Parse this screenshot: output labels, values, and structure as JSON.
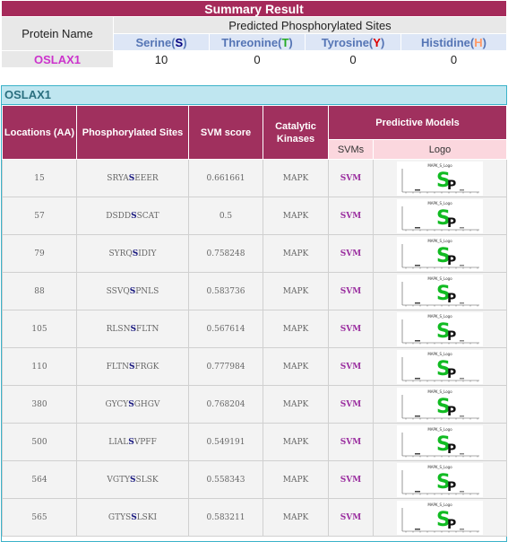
{
  "summary": {
    "title": "Summary Result",
    "protein_name_header": "Protein Name",
    "predicted_header": "Predicted Phosphorylated Sites",
    "residues": [
      {
        "prefix": "Serine(",
        "code": "S",
        "suffix": ")",
        "color": "#000080"
      },
      {
        "prefix": "Threonine(",
        "code": "T",
        "suffix": ")",
        "color": "#22aa22"
      },
      {
        "prefix": "Tyrosine(",
        "code": "Y",
        "suffix": ")",
        "color": "#dd0000"
      },
      {
        "prefix": "Histidine(",
        "code": "H",
        "suffix": ")",
        "color": "#ff9966"
      }
    ],
    "protein": "OSLAX1",
    "counts": [
      "10",
      "0",
      "0",
      "0"
    ]
  },
  "detail": {
    "protein": "OSLAX1",
    "headers": {
      "locations": "Locations (AA)",
      "sites": "Phosphorylated Sites",
      "score": "SVM score",
      "kinases": "Catalytic Kinases",
      "models": "Predictive Models",
      "svms": "SVMs",
      "logo": "Logo"
    },
    "logo_title": "MAPK_S_Logo",
    "rows": [
      {
        "loc": "15",
        "pre": "SRYA",
        "site": "S",
        "post": "EEER",
        "score": "0.661661",
        "kinase": "MAPK",
        "model": "SVM"
      },
      {
        "loc": "57",
        "pre": "DSDD",
        "site": "S",
        "post": "SCAT",
        "score": "0.5",
        "kinase": "MAPK",
        "model": "SVM"
      },
      {
        "loc": "79",
        "pre": "SYRQ",
        "site": "S",
        "post": "IDIY",
        "score": "0.758248",
        "kinase": "MAPK",
        "model": "SVM"
      },
      {
        "loc": "88",
        "pre": "SSVQ",
        "site": "S",
        "post": "PNLS",
        "score": "0.583736",
        "kinase": "MAPK",
        "model": "SVM"
      },
      {
        "loc": "105",
        "pre": "RLSN",
        "site": "S",
        "post": "FLTN",
        "score": "0.567614",
        "kinase": "MAPK",
        "model": "SVM"
      },
      {
        "loc": "110",
        "pre": "FLTN",
        "site": "S",
        "post": "FRGK",
        "score": "0.777984",
        "kinase": "MAPK",
        "model": "SVM"
      },
      {
        "loc": "380",
        "pre": "GYCY",
        "site": "S",
        "post": "GHGV",
        "score": "0.768204",
        "kinase": "MAPK",
        "model": "SVM"
      },
      {
        "loc": "500",
        "pre": "LIAL",
        "site": "S",
        "post": "VPFF",
        "score": "0.549191",
        "kinase": "MAPK",
        "model": "SVM"
      },
      {
        "loc": "564",
        "pre": "VGTY",
        "site": "S",
        "post": "SLSK",
        "score": "0.558343",
        "kinase": "MAPK",
        "model": "SVM"
      },
      {
        "loc": "565",
        "pre": "GTYS",
        "site": "S",
        "post": "LSKI",
        "score": "0.583211",
        "kinase": "MAPK",
        "model": "SVM"
      }
    ]
  }
}
